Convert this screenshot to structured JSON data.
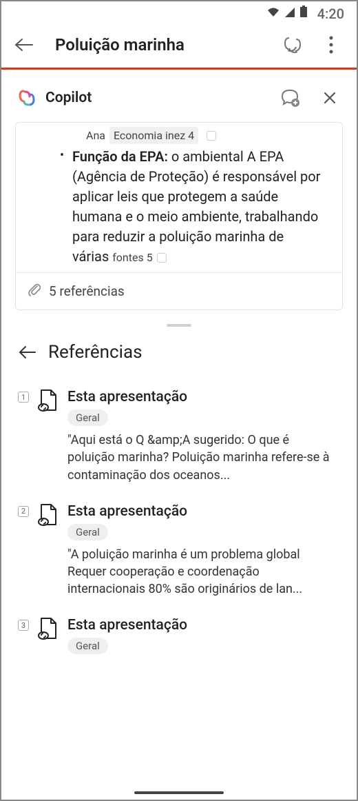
{
  "status": {
    "time": "4:20"
  },
  "header": {
    "title": "Poluição marinha"
  },
  "copilot": {
    "brand": "Copilot",
    "tags": {
      "a": "Ana",
      "b": "Economia inez 4"
    },
    "bullet_bold_prefix": "Função da EPA:",
    "bullet_rest": " o ambiental A EPA (Agência de Proteção) é responsável por aplicar leis que protegem a saúde humana e o meio ambiente, trabalhando para reduzir a poluição marinha de várias ",
    "fontes": "fontes 5",
    "references_count": "5 referências"
  },
  "references": {
    "title": "Referências",
    "items": [
      {
        "num": "1",
        "source": "Esta apresentação",
        "tag": "Geral",
        "text": "\"Aqui está o Q &amp;A sugerido:   O que é poluição marinha?     Poluição marinha refere-se à contaminação dos oceanos..."
      },
      {
        "num": "2",
        "source": "Esta apresentação",
        "tag": "Geral",
        "text": "\"A poluição marinha é um problema global Requer cooperação e coordenação internacionais 80% são originários de lan..."
      },
      {
        "num": "3",
        "source": "Esta apresentação",
        "tag": "Geral",
        "text": ""
      }
    ]
  }
}
